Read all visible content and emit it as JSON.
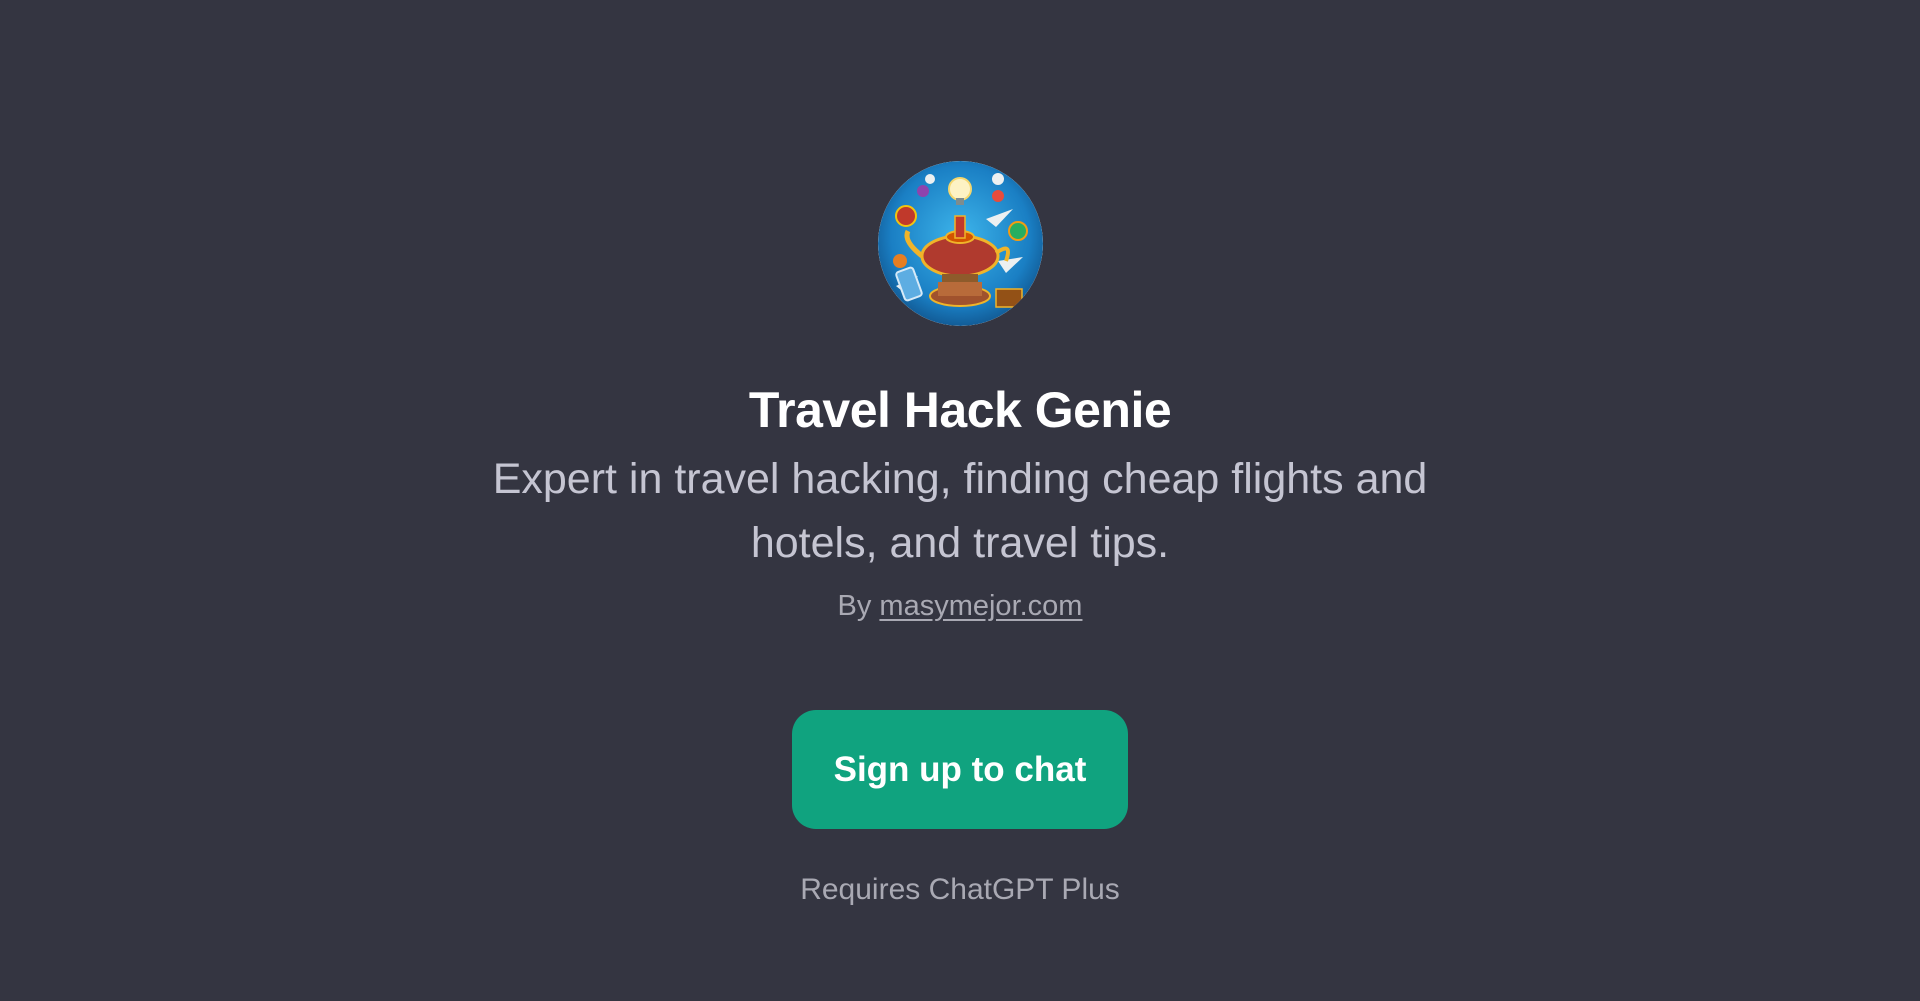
{
  "gpt": {
    "title": "Travel Hack Genie",
    "description": "Expert in travel hacking, finding cheap flights and hotels, and travel tips.",
    "by_prefix": "By",
    "author": "masymejor.com",
    "avatar_icon": "genie-lamp-icon"
  },
  "actions": {
    "signup_label": "Sign up to chat"
  },
  "footer": {
    "requirement": "Requires ChatGPT Plus"
  },
  "colors": {
    "background": "#343541",
    "accent": "#10a37f",
    "title": "#ffffff",
    "muted": "#a9a9b3"
  }
}
